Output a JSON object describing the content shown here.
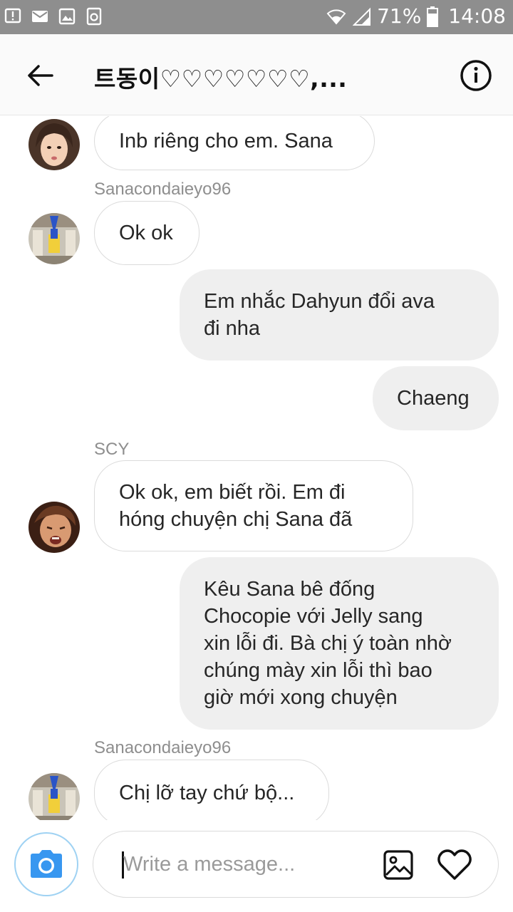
{
  "status_bar": {
    "battery_percent": "71%",
    "time": "14:08",
    "left_icons": [
      "alert-icon",
      "mail-icon",
      "image-icon",
      "recycle-icon"
    ],
    "right_icons": [
      "wifi-icon",
      "signal-icon",
      "battery-icon"
    ]
  },
  "header": {
    "title": "트동이♡♡♡♡♡♡♡,..."
  },
  "messages": [
    {
      "direction": "incoming",
      "sender": "",
      "text": "Inb riêng cho em. Sana",
      "avatar": "avatar-woman"
    },
    {
      "direction": "incoming",
      "sender": "Sanacondaieyo96",
      "text": "Ok ok",
      "avatar": "avatar-figure"
    },
    {
      "direction": "outgoing",
      "text_lines": [
        "Em nhắc Dahyun đổi ava",
        "đi nha"
      ]
    },
    {
      "direction": "outgoing",
      "text_lines": [
        "Chaeng"
      ]
    },
    {
      "direction": "incoming",
      "sender": "SCY",
      "text_lines": [
        "Ok ok, em biết rồi. Em đi",
        "hóng chuyện chị Sana đã"
      ],
      "avatar": "avatar-crying"
    },
    {
      "direction": "outgoing",
      "text_lines": [
        "Kêu Sana bê đống",
        "Chocopie với Jelly sang",
        "xin lỗi đi. Bà chị ý toàn nhờ",
        "chúng mày xin lỗi thì bao",
        "giờ mới xong chuyện"
      ]
    },
    {
      "direction": "incoming",
      "sender": "Sanacondaieyo96",
      "text": "Chị lỡ tay chứ bộ...",
      "avatar": "avatar-figure"
    }
  ],
  "composer": {
    "placeholder": "Write a message..."
  },
  "colors": {
    "status_bar": "#8e8e8e",
    "outgoing_bubble": "#efefef",
    "incoming_border": "#dbdbdb",
    "camera_blue": "#3897f0"
  }
}
